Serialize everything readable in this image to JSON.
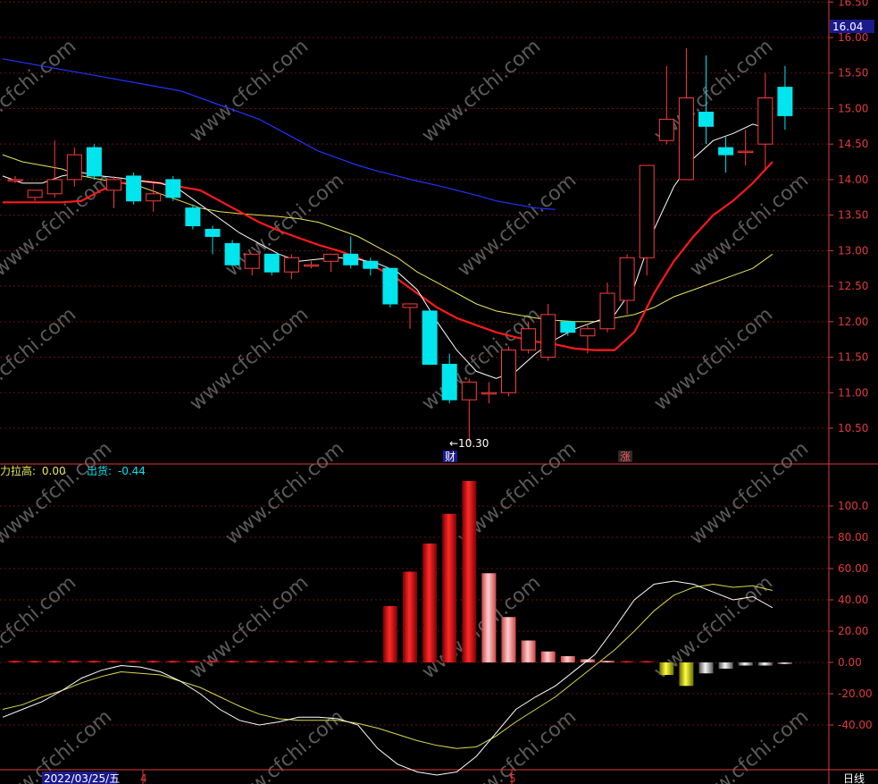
{
  "current_price": "16.04",
  "low_marker": "←10.30",
  "event_markers": [
    "财",
    "涨"
  ],
  "period_label": "日线",
  "date_label": "2022/03/25/五",
  "month_labels": [
    "4",
    "5"
  ],
  "watermark": "www.cfchi.com",
  "indicator_labels": {
    "line1_name": "力拉高:",
    "line1_value": "0.00",
    "line2_name": "出货:",
    "line2_value": "-0.44"
  },
  "colors": {
    "up": "#ff3b3b",
    "down": "#00e5ee",
    "ma_fast": "#ffffff",
    "ma_mid": "#ff1a1a",
    "ma_slow": "#e6e65a",
    "ma_long": "#2233ff",
    "axis": "#e23a3a",
    "grid": "#6b0f0f"
  },
  "chart_data": [
    {
      "type": "candlestick",
      "y_ticks": [
        "16.50",
        "16.00",
        "15.50",
        "15.00",
        "14.50",
        "14.00",
        "13.50",
        "13.00",
        "12.50",
        "12.00",
        "11.50",
        "11.00",
        "10.50"
      ],
      "ylim": [
        10.05,
        16.55
      ],
      "candles": [
        {
          "o": 14.0,
          "h": 14.05,
          "l": 13.95,
          "c": 14.0
        },
        {
          "o": 13.75,
          "h": 13.85,
          "l": 13.7,
          "c": 13.85
        },
        {
          "o": 13.8,
          "h": 14.55,
          "l": 13.75,
          "c": 14.0
        },
        {
          "o": 14.0,
          "h": 14.45,
          "l": 13.9,
          "c": 14.35
        },
        {
          "o": 14.45,
          "h": 14.5,
          "l": 14.0,
          "c": 14.05
        },
        {
          "o": 13.85,
          "h": 14.05,
          "l": 13.6,
          "c": 14.0
        },
        {
          "o": 14.05,
          "h": 14.1,
          "l": 13.65,
          "c": 13.7
        },
        {
          "o": 13.7,
          "h": 13.95,
          "l": 13.55,
          "c": 13.8
        },
        {
          "o": 14.0,
          "h": 14.05,
          "l": 13.7,
          "c": 13.75
        },
        {
          "o": 13.6,
          "h": 13.65,
          "l": 13.3,
          "c": 13.35
        },
        {
          "o": 13.3,
          "h": 13.35,
          "l": 12.95,
          "c": 13.2
        },
        {
          "o": 13.1,
          "h": 13.15,
          "l": 12.8,
          "c": 12.8
        },
        {
          "o": 12.75,
          "h": 12.95,
          "l": 12.65,
          "c": 12.95
        },
        {
          "o": 12.95,
          "h": 12.95,
          "l": 12.65,
          "c": 12.7
        },
        {
          "o": 12.7,
          "h": 12.95,
          "l": 12.6,
          "c": 12.9
        },
        {
          "o": 12.8,
          "h": 12.85,
          "l": 12.75,
          "c": 12.8
        },
        {
          "o": 12.85,
          "h": 12.95,
          "l": 12.7,
          "c": 12.95
        },
        {
          "o": 12.95,
          "h": 13.2,
          "l": 12.75,
          "c": 12.8
        },
        {
          "o": 12.85,
          "h": 12.9,
          "l": 12.65,
          "c": 12.75
        },
        {
          "o": 12.75,
          "h": 12.75,
          "l": 12.2,
          "c": 12.25
        },
        {
          "o": 12.2,
          "h": 12.25,
          "l": 11.9,
          "c": 12.25
        },
        {
          "o": 12.15,
          "h": 12.15,
          "l": 11.4,
          "c": 11.4
        },
        {
          "o": 11.4,
          "h": 11.55,
          "l": 10.85,
          "c": 10.9
        },
        {
          "o": 10.9,
          "h": 11.2,
          "l": 10.3,
          "c": 11.15
        },
        {
          "o": 11.0,
          "h": 11.15,
          "l": 10.85,
          "c": 11.0
        },
        {
          "o": 11.0,
          "h": 11.65,
          "l": 10.95,
          "c": 11.6
        },
        {
          "o": 11.6,
          "h": 12.0,
          "l": 11.55,
          "c": 11.9
        },
        {
          "o": 11.5,
          "h": 12.25,
          "l": 11.45,
          "c": 12.1
        },
        {
          "o": 12.0,
          "h": 12.0,
          "l": 11.8,
          "c": 11.85
        },
        {
          "o": 11.8,
          "h": 11.95,
          "l": 11.55,
          "c": 11.9
        },
        {
          "o": 11.9,
          "h": 12.55,
          "l": 11.85,
          "c": 12.4
        },
        {
          "o": 12.3,
          "h": 12.95,
          "l": 12.1,
          "c": 12.9
        },
        {
          "o": 12.9,
          "h": 13.6,
          "l": 12.65,
          "c": 14.2
        },
        {
          "o": 14.55,
          "h": 15.6,
          "l": 14.5,
          "c": 14.85
        },
        {
          "o": 14.0,
          "h": 15.85,
          "l": 14.0,
          "c": 15.15
        },
        {
          "o": 14.95,
          "h": 15.75,
          "l": 14.5,
          "c": 14.75
        },
        {
          "o": 14.45,
          "h": 14.6,
          "l": 14.1,
          "c": 14.35
        },
        {
          "o": 14.4,
          "h": 14.7,
          "l": 14.2,
          "c": 14.4
        },
        {
          "o": 14.5,
          "h": 15.5,
          "l": 14.15,
          "c": 15.15
        },
        {
          "o": 15.3,
          "h": 15.6,
          "l": 14.7,
          "c": 14.9
        }
      ],
      "ma_fast": [
        14.05,
        13.95,
        13.95,
        14.05,
        14.1,
        14.05,
        14.02,
        13.98,
        13.95,
        13.85,
        13.65,
        13.45,
        13.25,
        13.1,
        12.95,
        12.85,
        12.88,
        12.9,
        12.88,
        12.82,
        12.7,
        12.45,
        12.0,
        11.6,
        11.3,
        11.2,
        11.3,
        11.55,
        11.75,
        11.9,
        12.0,
        12.1,
        12.5,
        13.3,
        13.9,
        14.3,
        14.55,
        14.65,
        14.78,
        14.7
      ],
      "ma_mid": [
        13.68,
        13.68,
        13.68,
        13.68,
        13.7,
        13.85,
        13.95,
        13.98,
        13.95,
        13.9,
        13.85,
        13.7,
        13.55,
        13.4,
        13.28,
        13.18,
        13.08,
        13.0,
        12.9,
        12.75,
        12.6,
        12.4,
        12.2,
        12.05,
        11.95,
        11.85,
        11.78,
        11.72,
        11.68,
        11.62,
        11.6,
        11.6,
        11.85,
        12.4,
        12.85,
        13.2,
        13.5,
        13.7,
        13.95,
        14.25
      ],
      "ma_slow": [
        14.35,
        14.25,
        14.2,
        14.15,
        14.05,
        14.0,
        13.95,
        13.9,
        13.8,
        13.7,
        13.6,
        13.55,
        13.52,
        13.5,
        13.48,
        13.45,
        13.4,
        13.3,
        13.2,
        13.05,
        12.9,
        12.7,
        12.55,
        12.4,
        12.25,
        12.15,
        12.1,
        12.05,
        12.02,
        12.0,
        12.0,
        12.05,
        12.1,
        12.2,
        12.35,
        12.45,
        12.55,
        12.65,
        12.75,
        12.95
      ],
      "ma_long": [
        15.7,
        15.65,
        15.6,
        15.55,
        15.5,
        15.45,
        15.4,
        15.35,
        15.3,
        15.25,
        15.15,
        15.05,
        14.95,
        14.85,
        14.7,
        14.55,
        14.4,
        14.3,
        14.2,
        14.12,
        14.05,
        13.98,
        13.92,
        13.85,
        13.78,
        13.7,
        13.65,
        13.6,
        13.58
      ]
    },
    {
      "type": "bar",
      "title": "",
      "y_ticks": [
        "100.0",
        "80.00",
        "60.00",
        "40.00",
        "20.00",
        "0.00",
        "-20.00",
        "-40.00"
      ],
      "ylim": [
        -70,
        122
      ],
      "categories": [
        0,
        1,
        2,
        3,
        4,
        5,
        6,
        7,
        8,
        9,
        10,
        11,
        12,
        13,
        14,
        15,
        16,
        17,
        18,
        19,
        20,
        21,
        22,
        23,
        24,
        25,
        26,
        27,
        28,
        29,
        30,
        31,
        32,
        33,
        34,
        35,
        36,
        37,
        38,
        39
      ],
      "series": [
        {
          "values": [
            1,
            1,
            1,
            1,
            1,
            1,
            1,
            1,
            1,
            1,
            1,
            1,
            1,
            1,
            1,
            1,
            1,
            1,
            1,
            36,
            58,
            76,
            95,
            116,
            57,
            29,
            14,
            7,
            4,
            2,
            1,
            0,
            0,
            -8,
            -15,
            -7,
            -4,
            -2,
            -2,
            -1
          ]
        },
        {
          "values": [
            -35,
            -30,
            -25,
            -18,
            -10,
            -5,
            -2,
            -3,
            -6,
            -12,
            -20,
            -30,
            -37,
            -40,
            -38,
            -35,
            -35,
            -36,
            -40,
            -55,
            -65,
            -70,
            -72,
            -70,
            -60,
            -45,
            -30,
            -22,
            -15,
            -5,
            5,
            22,
            40,
            50,
            52,
            50,
            45,
            40,
            42,
            35
          ]
        },
        {
          "values": [
            -30,
            -27,
            -22,
            -18,
            -13,
            -9,
            -6,
            -7,
            -8,
            -12,
            -16,
            -22,
            -28,
            -33,
            -36,
            -37,
            -37,
            -37,
            -39,
            -42,
            -46,
            -50,
            -53,
            -55,
            -54,
            -47,
            -38,
            -30,
            -22,
            -12,
            -2,
            8,
            20,
            33,
            43,
            48,
            50,
            48,
            49,
            46
          ]
        }
      ]
    }
  ]
}
